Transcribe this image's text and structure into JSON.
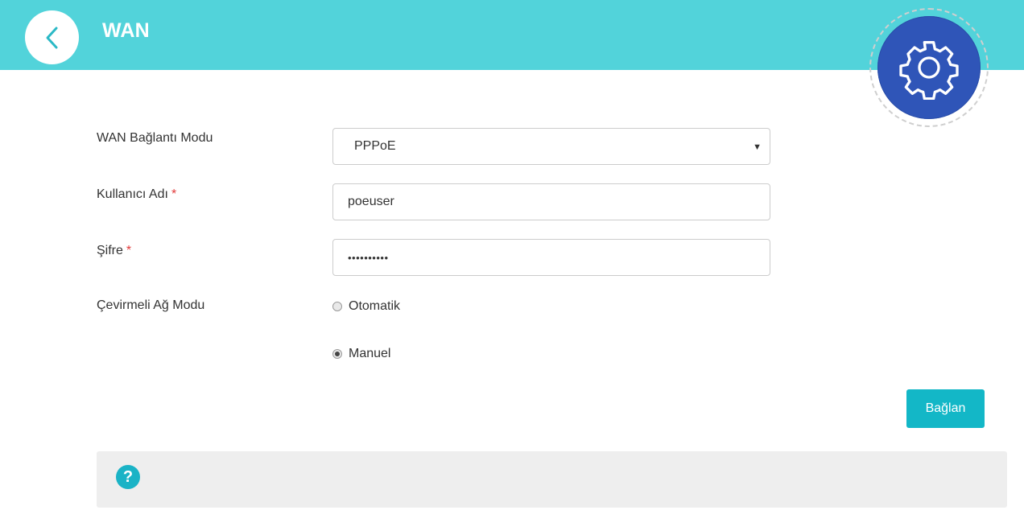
{
  "header": {
    "title": "WAN",
    "background_color": "#52d3da",
    "back_icon": "chevron-left-icon",
    "settings_icon": "gear-icon",
    "settings_color": "#2f55b8"
  },
  "form": {
    "wan_mode": {
      "label": "WAN Bağlantı Modu",
      "value": "PPPoE"
    },
    "username": {
      "label": "Kullanıcı Adı",
      "required_mark": "*",
      "value": "poeuser"
    },
    "password": {
      "label": "Şifre",
      "required_mark": "*",
      "value": "••••••••••"
    },
    "dial_mode": {
      "label": "Çevirmeli Ağ Modu",
      "options": [
        {
          "label": "Otomatik",
          "selected": false
        },
        {
          "label": "Manuel",
          "selected": true
        }
      ]
    }
  },
  "actions": {
    "connect_label": "Bağlan",
    "accent_color": "#13b7c7"
  },
  "help": {
    "icon": "question-icon",
    "icon_text": "?"
  }
}
